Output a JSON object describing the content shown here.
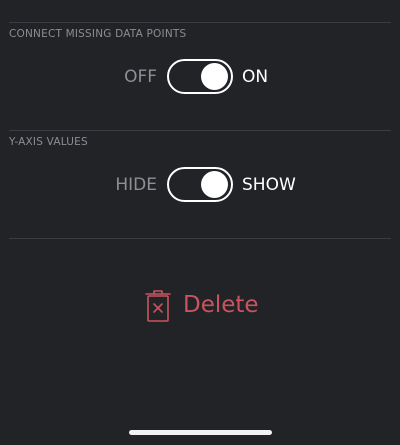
{
  "sections": {
    "connect_missing": {
      "title": "CONNECT MISSING DATA POINTS",
      "off_label": "OFF",
      "on_label": "ON",
      "value": "ON"
    },
    "y_axis": {
      "title": "Y-AXIS VALUES",
      "off_label": "HIDE",
      "on_label": "SHOW",
      "value": "SHOW"
    }
  },
  "actions": {
    "delete_label": "Delete",
    "delete_icon": "trash-icon"
  },
  "colors": {
    "background": "#222327",
    "danger": "#c9545e",
    "toggle": "#ffffff"
  }
}
